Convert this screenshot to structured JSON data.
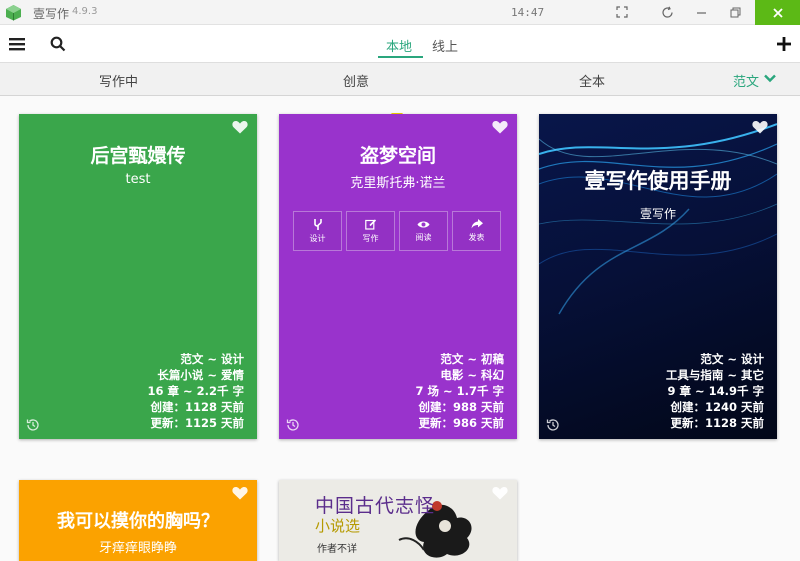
{
  "titlebar": {
    "app_name": "壹写作",
    "version": "4.9.3",
    "clock": "14:47"
  },
  "toolbar": {
    "tabs": [
      {
        "label": "本地"
      },
      {
        "label": "线上"
      }
    ]
  },
  "subtabs": {
    "items": [
      {
        "label": "写作中"
      },
      {
        "label": "创意"
      },
      {
        "label": "全本"
      }
    ],
    "sample_label": "范文"
  },
  "colors": {
    "accent": "#2aa67d",
    "green_card": "#3aa64b",
    "purple_card": "#9933cc",
    "orange_card": "#fba200",
    "close": "#5cb916"
  },
  "cards": [
    {
      "title": "后宫甄嬛传",
      "author": "test",
      "favorite": false,
      "meta": [
        "范文 ~ 设计",
        "长篇小说 ~ 爱情",
        "16 章 ~ 2.2千 字",
        "创建：1128 天前",
        "更新：1125 天前"
      ]
    },
    {
      "title": "盗梦空间",
      "author": "克里斯托弗·诺兰",
      "favorite": false,
      "actions": [
        {
          "label": "设计",
          "icon": "fork-icon"
        },
        {
          "label": "写作",
          "icon": "edit-icon"
        },
        {
          "label": "阅读",
          "icon": "eye-icon"
        },
        {
          "label": "发表",
          "icon": "share-icon"
        }
      ],
      "meta": [
        "范文 ~ 初稿",
        "电影 ~ 科幻",
        "7 场 ~ 1.7千 字",
        "创建：988 天前",
        "更新：986 天前"
      ]
    },
    {
      "title": "壹写作使用手册",
      "author": "壹写作",
      "favorite": false,
      "meta": [
        "范文 ~ 设计",
        "工具与指南 ~ 其它",
        "9 章 ~ 14.9千 字",
        "创建：1240 天前",
        "更新：1128 天前"
      ]
    },
    {
      "title": "我可以摸你的胸吗？",
      "author": "牙痒痒眼睁睁",
      "favorite": false
    },
    {
      "cover_title": "中国古代志怪",
      "cover_subtitle": "小说选",
      "cover_author": "作者不详",
      "favorite": false
    }
  ]
}
